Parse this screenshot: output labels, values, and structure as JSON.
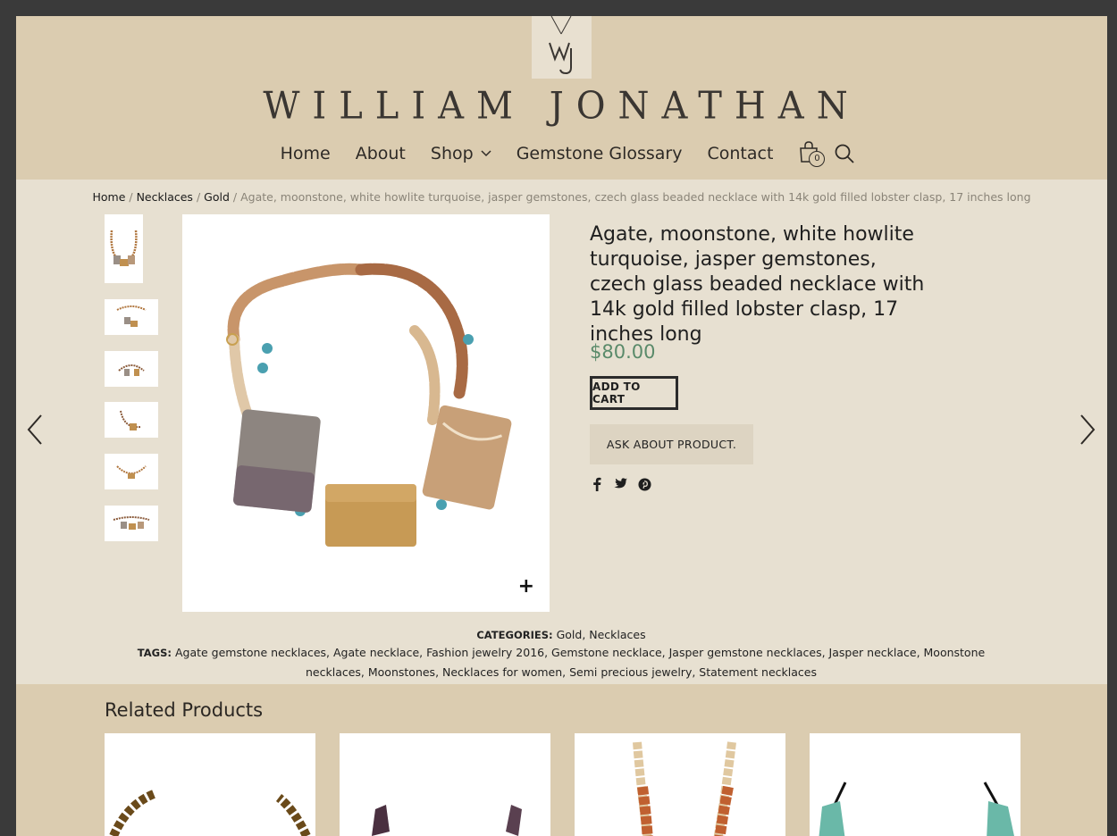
{
  "site": {
    "brand": "WILLIAM JONATHAN"
  },
  "nav": {
    "items": [
      {
        "label": "Home"
      },
      {
        "label": "About"
      },
      {
        "label": "Shop"
      },
      {
        "label": "Gemstone Glossary"
      },
      {
        "label": "Contact"
      }
    ],
    "cart_count": "0"
  },
  "breadcrumb": {
    "home": "Home",
    "necklaces": "Necklaces",
    "gold": "Gold",
    "current": "Agate, moonstone, white howlite turquoise, jasper gemstones, czech glass beaded necklace with 14k gold filled lobster clasp, 17 inches long",
    "separator": "/"
  },
  "product": {
    "title": "Agate, moonstone, white howlite turquoise, jasper gemstones, czech glass beaded necklace with 14k gold filled lobster clasp, 17 inches long",
    "price": "$80.00",
    "add_to_cart": "ADD TO CART",
    "ask": "ASK ABOUT PRODUCT.",
    "zoom": "+"
  },
  "meta": {
    "categories_label": "CATEGORIES:",
    "categories": "Gold, Necklaces",
    "tags_label": "TAGS:",
    "tags": "Agate gemstone necklaces, Agate necklace, Fashion jewelry 2016, Gemstone necklace, Jasper gemstone necklaces, Jasper necklace, Moonstone necklaces, Moonstones, Necklaces for women, Semi precious jewelry, Statement necklaces"
  },
  "related": {
    "title": "Related Products"
  },
  "colors": {
    "header_bg": "#dbccb0",
    "page_bg": "#e7e0d1",
    "price": "#5a8a6a"
  }
}
